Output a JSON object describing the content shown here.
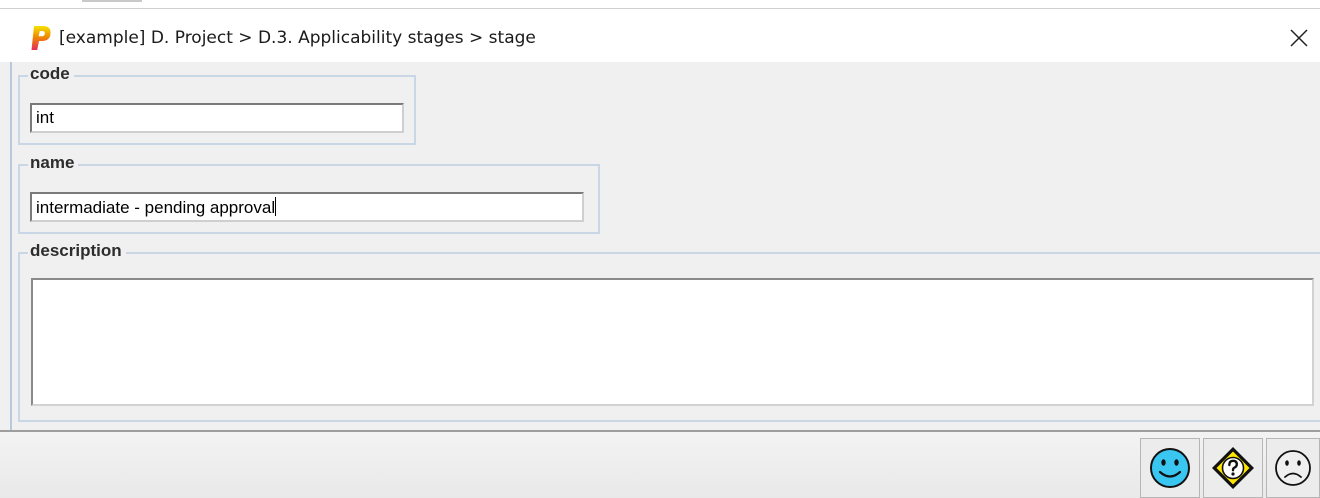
{
  "window": {
    "title": "[example] D. Project > D.3. Applicability stages > stage",
    "app_icon_letter": "P",
    "close_icon": "close-icon"
  },
  "form": {
    "code": {
      "label": "code",
      "value": "int"
    },
    "name": {
      "label": "name",
      "value": "intermadiate - pending approval"
    },
    "description": {
      "label": "description",
      "value": ""
    }
  },
  "actions": {
    "ok_icon": "smiley-face-icon",
    "help_icon": "question-diamond-icon",
    "cancel_icon": "sad-face-icon"
  },
  "colors": {
    "window_bg": "#f0f0f0",
    "group_border": "#c9d6e6",
    "ok_face": "#39c6f0",
    "help_sign": "#ffe600"
  }
}
